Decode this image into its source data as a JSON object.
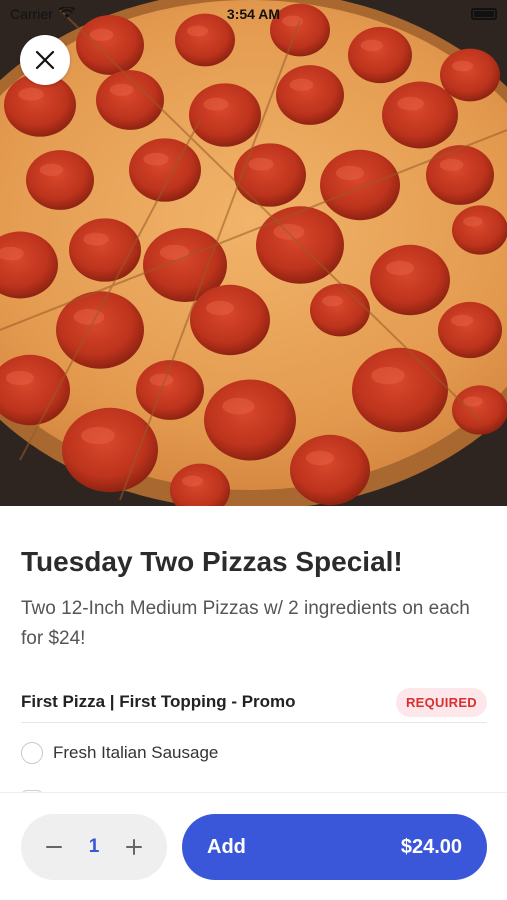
{
  "status_bar": {
    "carrier": "Carrier",
    "time": "3:54 AM"
  },
  "hero": {
    "image_subject": "pepperoni pizza",
    "colors": {
      "cheese": "#e9a35a",
      "pepperoni": "#c0361f",
      "crust": "#b8733a"
    }
  },
  "item": {
    "title": "Tuesday Two Pizzas Special!",
    "description": "Two 12-Inch Medium Pizzas w/ 2 ingredients on each for $24!"
  },
  "section": {
    "title": "First Pizza | First Topping - Promo",
    "badge": "REQUIRED",
    "options": [
      {
        "label": "Fresh Italian Sausage",
        "selected": false
      }
    ]
  },
  "footer": {
    "quantity": "1",
    "add_label": "Add",
    "price": "$24.00"
  },
  "colors": {
    "accent": "#3a57d9",
    "required_text": "#d9302f",
    "required_bg": "#fde7ea",
    "stepper_bg": "#efefef"
  },
  "icons": {
    "close": "close-icon",
    "minus": "minus-icon",
    "plus": "plus-icon",
    "wifi": "wifi-icon",
    "battery": "battery-icon"
  }
}
